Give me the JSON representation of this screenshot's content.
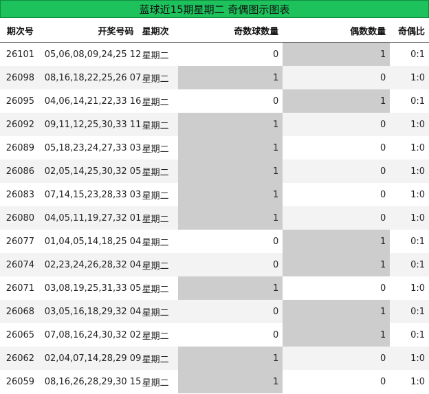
{
  "title": "蓝球近15期星期二 奇偶图示图表",
  "headers": {
    "period": "期次号",
    "draw": "开奖号码",
    "weekday": "星期次",
    "odd_count": "奇数球数量",
    "even_count": "偶数数量",
    "ratio": "奇偶比"
  },
  "rows": [
    {
      "period": "26101",
      "draw": "05,06,08,09,24,25 12",
      "weekday": "星期二",
      "odd": "0",
      "even": "1",
      "ratio": "0:1"
    },
    {
      "period": "26098",
      "draw": "08,16,18,22,25,26 07",
      "weekday": "星期二",
      "odd": "1",
      "even": "0",
      "ratio": "1:0"
    },
    {
      "period": "26095",
      "draw": "04,06,14,21,22,33 16",
      "weekday": "星期二",
      "odd": "0",
      "even": "1",
      "ratio": "0:1"
    },
    {
      "period": "26092",
      "draw": "09,11,12,25,30,33 11",
      "weekday": "星期二",
      "odd": "1",
      "even": "0",
      "ratio": "1:0"
    },
    {
      "period": "26089",
      "draw": "05,18,23,24,27,33 03",
      "weekday": "星期二",
      "odd": "1",
      "even": "0",
      "ratio": "1:0"
    },
    {
      "period": "26086",
      "draw": "02,05,14,25,30,32 05",
      "weekday": "星期二",
      "odd": "1",
      "even": "0",
      "ratio": "1:0"
    },
    {
      "period": "26083",
      "draw": "07,14,15,23,28,33 03",
      "weekday": "星期二",
      "odd": "1",
      "even": "0",
      "ratio": "1:0"
    },
    {
      "period": "26080",
      "draw": "04,05,11,19,27,32 01",
      "weekday": "星期二",
      "odd": "1",
      "even": "0",
      "ratio": "1:0"
    },
    {
      "period": "26077",
      "draw": "01,04,05,14,18,25 04",
      "weekday": "星期二",
      "odd": "0",
      "even": "1",
      "ratio": "0:1"
    },
    {
      "period": "26074",
      "draw": "02,23,24,26,28,32 04",
      "weekday": "星期二",
      "odd": "0",
      "even": "1",
      "ratio": "0:1"
    },
    {
      "period": "26071",
      "draw": "03,08,19,25,31,33 05",
      "weekday": "星期二",
      "odd": "1",
      "even": "0",
      "ratio": "1:0"
    },
    {
      "period": "26068",
      "draw": "03,05,16,18,29,32 04",
      "weekday": "星期二",
      "odd": "0",
      "even": "1",
      "ratio": "0:1"
    },
    {
      "period": "26065",
      "draw": "07,08,16,24,30,32 02",
      "weekday": "星期二",
      "odd": "0",
      "even": "1",
      "ratio": "0:1"
    },
    {
      "period": "26062",
      "draw": "02,04,07,14,28,29 09",
      "weekday": "星期二",
      "odd": "1",
      "even": "0",
      "ratio": "1:0"
    },
    {
      "period": "26059",
      "draw": "08,16,26,28,29,30 15",
      "weekday": "星期二",
      "odd": "1",
      "even": "0",
      "ratio": "1:0"
    }
  ],
  "colors": {
    "title_bg": "#1dc25c",
    "highlight": "#cdcdcd",
    "row_alt": "#f3f3f3"
  }
}
